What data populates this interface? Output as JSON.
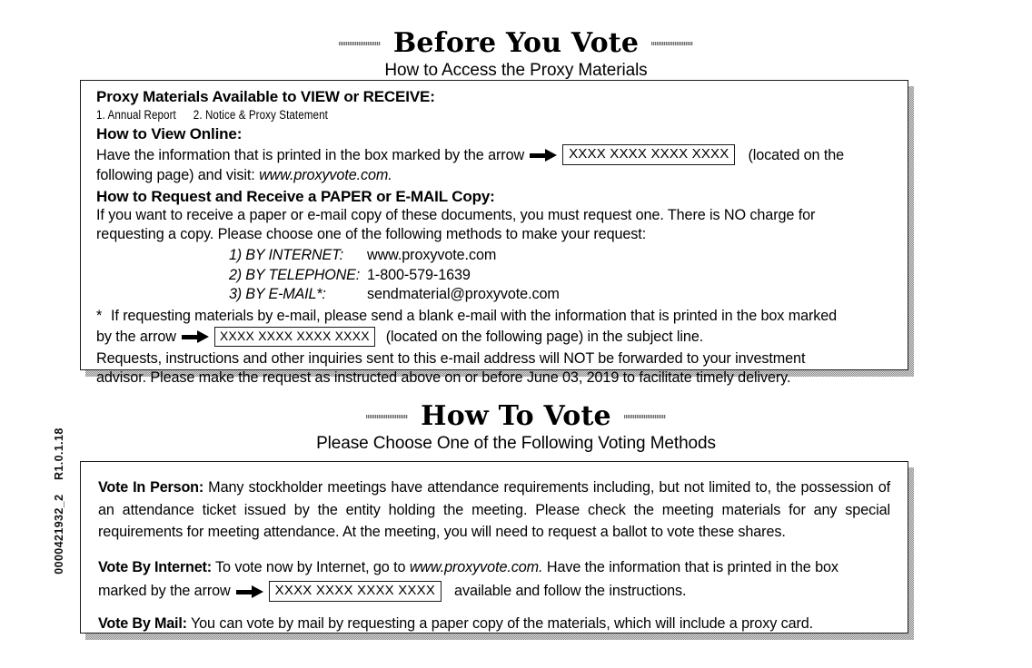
{
  "side_code": "0000421932_2    R1.0.1.18",
  "section1": {
    "title": "Before You Vote",
    "subtitle": "How to Access the Proxy Materials",
    "heading_materials": "Proxy Materials Available to VIEW or RECEIVE:",
    "materials_item_1": "1. Annual Report",
    "materials_item_2": "2. Notice & Proxy Statement",
    "heading_view_online": "How to View Online:",
    "view_line_1a": "Have the information that is printed in the box marked by the arrow",
    "view_code": "XXXX XXXX XXXX XXXX",
    "view_line_1b": "(located on the",
    "view_line_2a": "following page) and visit:",
    "view_site": "www.proxyvote.com.",
    "heading_request": "How to Request and Receive a PAPER or E-MAIL Copy:",
    "request_line_1": "If you want to receive a paper or e-mail copy of these documents, you must request one.  There is NO charge for",
    "request_line_2": "requesting a copy.  Please choose one of the following methods to make your request:",
    "methods": [
      {
        "label": "1) BY INTERNET:",
        "value": "www.proxyvote.com"
      },
      {
        "label": "2) BY TELEPHONE:",
        "value": "1-800-579-1639"
      },
      {
        "label": "3) BY E-MAIL*:",
        "value": "sendmaterial@proxyvote.com"
      }
    ],
    "footnote_star": "*",
    "footnote_line_1": "If requesting materials by e-mail, please send a blank e-mail with the information that is printed in the box marked",
    "footnote_line_2a": "by the arrow",
    "footnote_code": "XXXX XXXX XXXX XXXX",
    "footnote_line_2b": "(located on the following page) in the subject line.",
    "closing_line_1": "Requests, instructions and other inquiries sent to this e-mail address will NOT be forwarded to your investment",
    "closing_line_2": "advisor. Please make the request as instructed above on or before June 03, 2019 to facilitate timely delivery."
  },
  "section2": {
    "title": "How To Vote",
    "subtitle": "Please Choose One of the Following Voting Methods",
    "in_person_label": "Vote In Person:",
    "in_person_text": " Many stockholder meetings have attendance requirements including, but not limited to, the possession of an attendance ticket issued by the entity holding the meeting. Please check the meeting materials for any special requirements for meeting attendance.  At the meeting, you will need to request a ballot to vote these shares.",
    "internet_label": "Vote By Internet:",
    "internet_text_a": " To vote now by Internet, go to",
    "internet_site": "www.proxyvote.com.",
    "internet_text_b": " Have the information that is printed in the box",
    "internet_text_c": "marked by the arrow",
    "internet_code": "XXXX XXXX XXXX XXXX",
    "internet_text_d": "available and follow the instructions.",
    "mail_label": "Vote By Mail:",
    "mail_text": " You can vote by mail by requesting a paper copy of the materials, which will include a proxy card."
  }
}
